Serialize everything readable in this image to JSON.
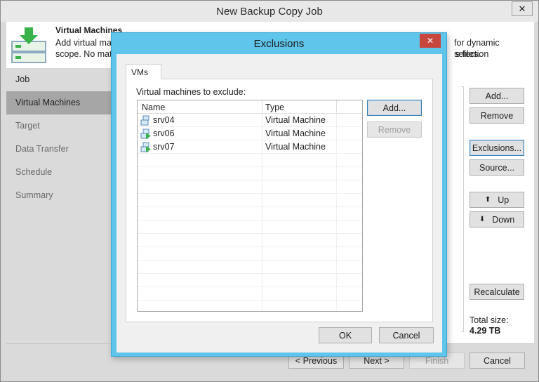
{
  "window": {
    "title": "New Backup Copy Job",
    "close_label": "✕"
  },
  "header": {
    "title": "Virtual Machines",
    "desc_line1": "Add virtual ma",
    "desc_line1_end": "for dynamic selection",
    "desc_line2": "scope. No matt",
    "desc_line2_end": "s files."
  },
  "sidebar": {
    "items": [
      {
        "label": "Job"
      },
      {
        "label": "Virtual Machines"
      },
      {
        "label": "Target"
      },
      {
        "label": "Data Transfer"
      },
      {
        "label": "Schedule"
      },
      {
        "label": "Summary"
      }
    ]
  },
  "right_buttons": {
    "add": "Add...",
    "remove": "Remove",
    "exclusions": "Exclusions...",
    "source": "Source...",
    "up": "Up",
    "down": "Down",
    "recalculate": "Recalculate"
  },
  "total": {
    "label": "Total size:",
    "value": "4.29 TB"
  },
  "footer": {
    "previous": "< Previous",
    "next": "Next >",
    "finish": "Finish",
    "cancel": "Cancel"
  },
  "dialog": {
    "title": "Exclusions",
    "close_label": "✕",
    "tab": "VMs",
    "list_label": "Virtual machines to exclude:",
    "columns": {
      "name": "Name",
      "type": "Type"
    },
    "rows": [
      {
        "name": "srv04",
        "type": "Virtual Machine",
        "running": false
      },
      {
        "name": "srv06",
        "type": "Virtual Machine",
        "running": true
      },
      {
        "name": "srv07",
        "type": "Virtual Machine",
        "running": true
      }
    ],
    "add": "Add...",
    "remove": "Remove",
    "ok": "OK",
    "cancel": "Cancel"
  },
  "colors": {
    "dialog_frame": "#5fc5ea",
    "close_red": "#c7463d",
    "sidebar_active": "#a6a6a6",
    "icon_green": "#3ab24a"
  }
}
